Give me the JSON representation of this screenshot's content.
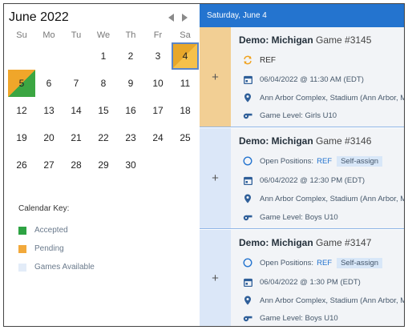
{
  "calendar": {
    "month_title": "June 2022",
    "weekdays": [
      "Su",
      "Mo",
      "Tu",
      "We",
      "Th",
      "Fr",
      "Sa"
    ],
    "days": [
      {
        "label": "1",
        "state": "none"
      },
      {
        "label": "2",
        "state": "none"
      },
      {
        "label": "3",
        "state": "none"
      },
      {
        "label": "4",
        "state": "selected"
      },
      {
        "label": "5",
        "state": "accepted-pending"
      },
      {
        "label": "6",
        "state": "none"
      },
      {
        "label": "7",
        "state": "none"
      },
      {
        "label": "8",
        "state": "none"
      },
      {
        "label": "9",
        "state": "none"
      },
      {
        "label": "10",
        "state": "none"
      },
      {
        "label": "11",
        "state": "none"
      },
      {
        "label": "12",
        "state": "none"
      },
      {
        "label": "13",
        "state": "none"
      },
      {
        "label": "14",
        "state": "none"
      },
      {
        "label": "15",
        "state": "none"
      },
      {
        "label": "16",
        "state": "none"
      },
      {
        "label": "17",
        "state": "none"
      },
      {
        "label": "18",
        "state": "none"
      },
      {
        "label": "19",
        "state": "none"
      },
      {
        "label": "20",
        "state": "none"
      },
      {
        "label": "21",
        "state": "none"
      },
      {
        "label": "22",
        "state": "none"
      },
      {
        "label": "23",
        "state": "none"
      },
      {
        "label": "24",
        "state": "none"
      },
      {
        "label": "25",
        "state": "none"
      },
      {
        "label": "26",
        "state": "none"
      },
      {
        "label": "27",
        "state": "none"
      },
      {
        "label": "28",
        "state": "none"
      },
      {
        "label": "29",
        "state": "none"
      },
      {
        "label": "30",
        "state": "none"
      }
    ],
    "nav_icons": {
      "prev": "triangle-left-icon",
      "next": "triangle-right-icon"
    }
  },
  "key": {
    "title": "Calendar Key:",
    "items": [
      {
        "label": "Accepted",
        "color": "#2ea343"
      },
      {
        "label": "Pending",
        "color": "#f2a93b"
      },
      {
        "label": "Games Available",
        "color": "#e3ecf8"
      }
    ]
  },
  "panel": {
    "header": "Saturday, June 4",
    "games": [
      {
        "org": "Demo: Michigan",
        "game": "Game #3145",
        "status_icon": "sync-icon",
        "status": "REF",
        "datetime": "06/04/2022 @ 11:30 AM (EDT)",
        "location": "Ann Arbor Complex, Stadium (Ann Arbor, MI)",
        "level": "Game Level: Girls U10"
      },
      {
        "org": "Demo: Michigan",
        "game": "Game #3146",
        "status_icon": "open-circle-icon",
        "status": "Open Positions:",
        "position": "REF",
        "assign_label": "Self-assign",
        "datetime": "06/04/2022 @ 12:30 PM (EDT)",
        "location": "Ann Arbor Complex, Stadium (Ann Arbor, MI)",
        "level": "Game Level: Boys U10"
      },
      {
        "org": "Demo: Michigan",
        "game": "Game #3147",
        "status_icon": "open-circle-icon",
        "status": "Open Positions:",
        "position": "REF",
        "assign_label": "Self-assign",
        "datetime": "06/04/2022 @ 1:30 PM (EDT)",
        "location": "Ann Arbor Complex, Stadium (Ann Arbor, MI)",
        "level": "Game Level: Boys U10"
      }
    ],
    "expand_label": "+"
  },
  "colors": {
    "accent": "#2474cf",
    "accepted": "#2ea343",
    "pending": "#f2a93b",
    "available": "#e3ecf8"
  }
}
